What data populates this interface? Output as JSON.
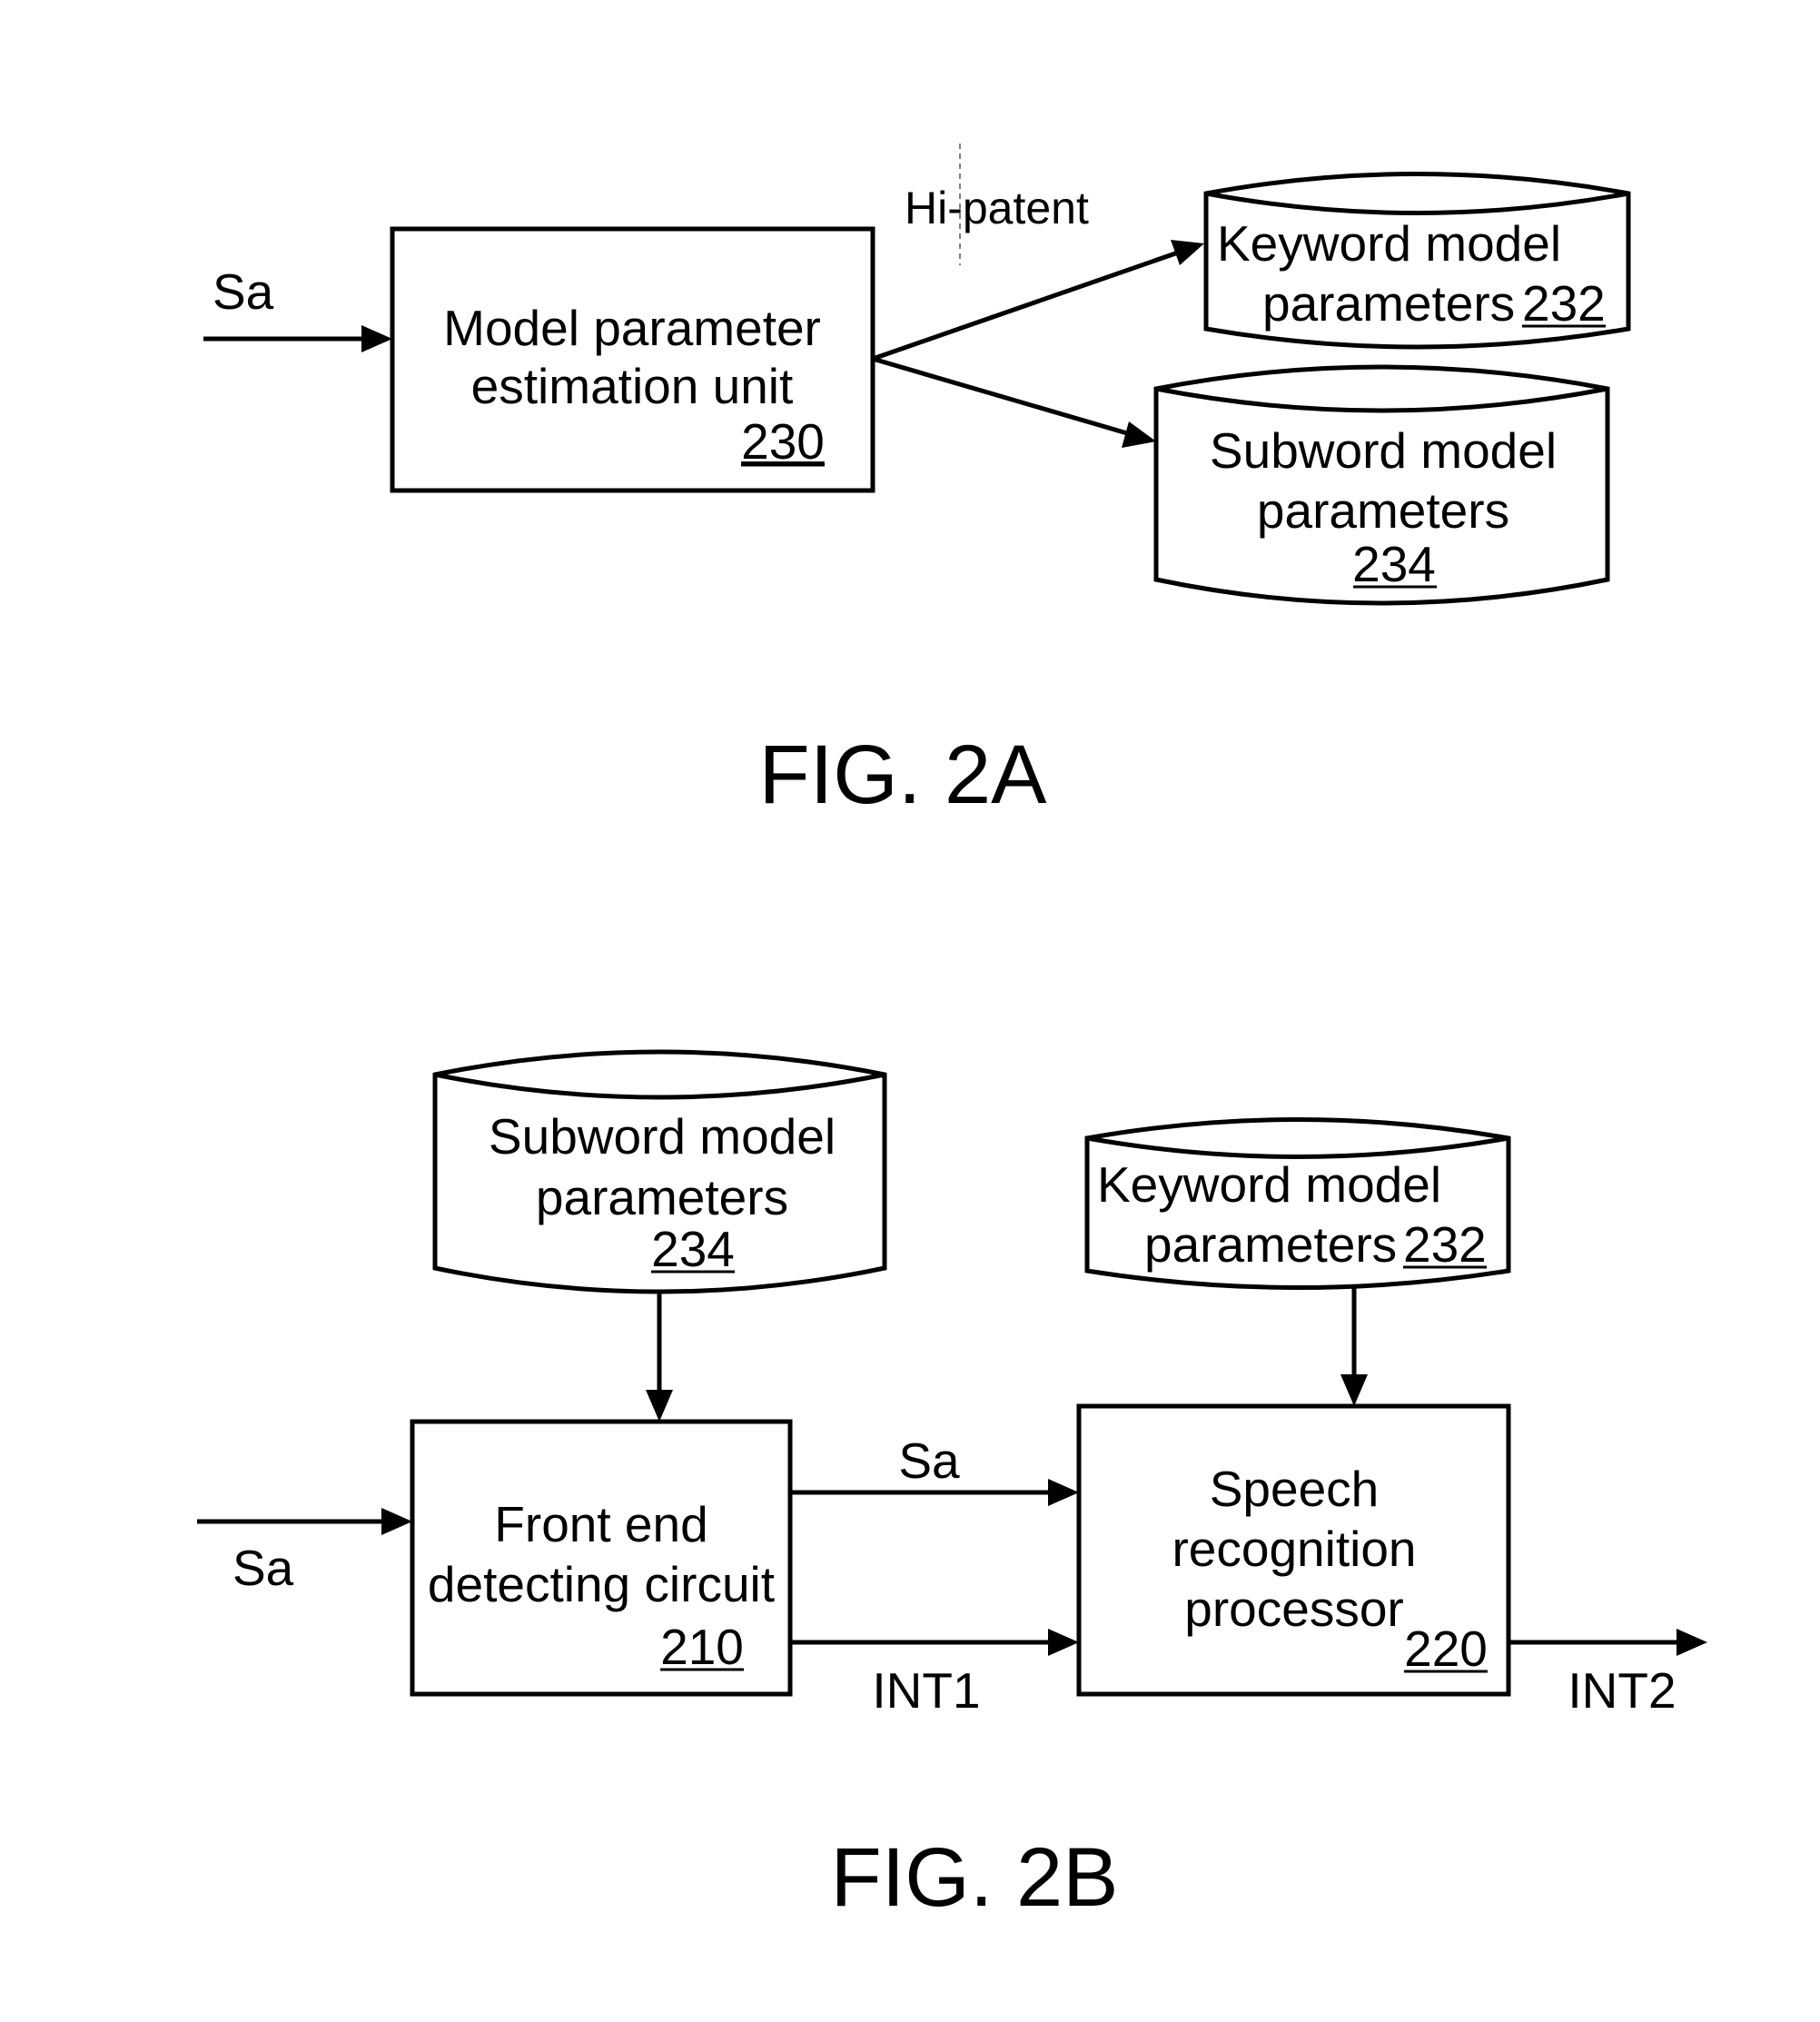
{
  "fig2a": {
    "caption": "FIG. 2A",
    "input_label": "Sa",
    "watermark": "Hi-patent",
    "estimation_unit": {
      "line1": "Model parameter",
      "line2": "estimation unit",
      "ref": "230"
    },
    "keyword_db": {
      "line1": "Keyword model",
      "line2": "parameters",
      "ref": "232"
    },
    "subword_db": {
      "line1": "Subword model",
      "line2": "parameters",
      "ref": "234"
    }
  },
  "fig2b": {
    "caption": "FIG. 2B",
    "input_label": "Sa",
    "subword_db": {
      "line1": "Subword model",
      "line2": "parameters",
      "ref": "234"
    },
    "keyword_db": {
      "line1": "Keyword model",
      "line2": "parameters",
      "ref": "232"
    },
    "front_end": {
      "line1": "Front end",
      "line2": "detecting circuit",
      "ref": "210"
    },
    "recognizer": {
      "line1": "Speech",
      "line2": "recognition",
      "line3": "processor",
      "ref": "220"
    },
    "signal_sa": "Sa",
    "signal_int1": "INT1",
    "signal_int2": "INT2"
  }
}
